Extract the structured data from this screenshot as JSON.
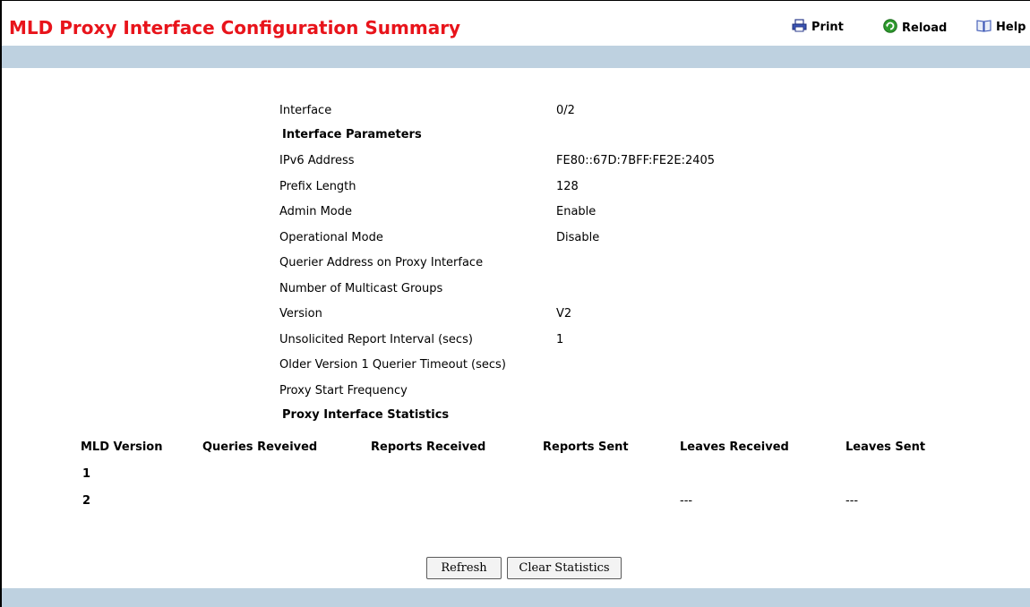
{
  "header": {
    "title": "MLD Proxy Interface Configuration Summary",
    "print_label": "Print",
    "reload_label": "Reload",
    "help_label": "Help"
  },
  "fields": [
    {
      "label": "Interface",
      "value": "0/2"
    },
    {
      "label": "IPv6 Address",
      "value": "FE80::67D:7BFF:FE2E:2405"
    },
    {
      "label": "Prefix Length",
      "value": "128"
    },
    {
      "label": "Admin Mode",
      "value": "Enable"
    },
    {
      "label": "Operational Mode",
      "value": "Disable"
    },
    {
      "label": "Querier Address on Proxy Interface",
      "value": ""
    },
    {
      "label": "Number of Multicast Groups",
      "value": ""
    },
    {
      "label": "Version",
      "value": "V2"
    },
    {
      "label": "Unsolicited Report Interval (secs)",
      "value": "1"
    },
    {
      "label": "Older Version 1 Querier Timeout (secs)",
      "value": ""
    },
    {
      "label": "Proxy Start Frequency",
      "value": ""
    }
  ],
  "sections": {
    "parameters": "Interface Parameters",
    "statistics": "Proxy Interface Statistics"
  },
  "stats_table": {
    "headers": [
      "MLD Version",
      "Queries Reveived",
      "Reports Received",
      "Reports Sent",
      "Leaves Received",
      "Leaves Sent"
    ],
    "rows": [
      {
        "version": "1",
        "queries": "",
        "reports_received": "",
        "reports_sent": "",
        "leaves_received": "",
        "leaves_sent": ""
      },
      {
        "version": "2",
        "queries": "",
        "reports_received": "",
        "reports_sent": "",
        "leaves_received": "---",
        "leaves_sent": "---"
      }
    ]
  },
  "buttons": {
    "refresh": "Refresh",
    "clear_statistics": "Clear Statistics"
  },
  "colors": {
    "title": "#e8141b",
    "bar": "#bed1e0"
  },
  "icons": {
    "print": "printer-icon",
    "reload": "reload-icon",
    "help": "book-icon"
  }
}
